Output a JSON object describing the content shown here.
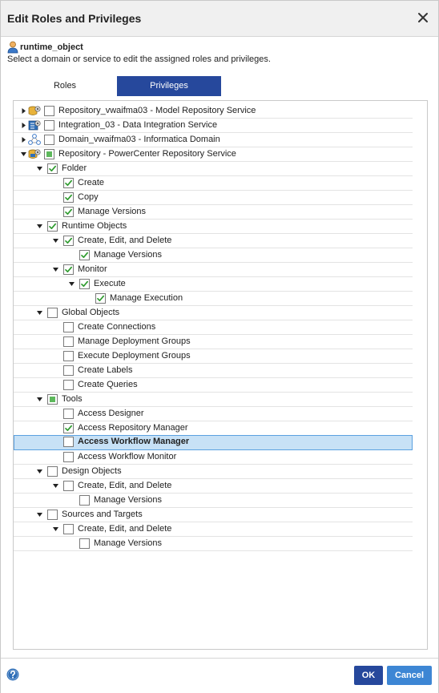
{
  "dialog": {
    "title": "Edit Roles and Privileges",
    "object_name": "runtime_object",
    "instructions": "Select a domain or service to edit the assigned roles and privileges."
  },
  "tabs": [
    {
      "label": "Roles",
      "active": false
    },
    {
      "label": "Privileges",
      "active": true
    }
  ],
  "tree": [
    {
      "label": "Repository_vwaifma03 - Model Repository Service",
      "level": 0,
      "expander": "collapsed",
      "check": "unchecked",
      "icon": "model-repository-icon"
    },
    {
      "label": "Integration_03 - Data Integration Service",
      "level": 0,
      "expander": "collapsed",
      "check": "unchecked",
      "icon": "data-integration-icon"
    },
    {
      "label": "Domain_vwaifma03 - Informatica Domain",
      "level": 0,
      "expander": "collapsed",
      "check": "unchecked",
      "icon": "domain-icon"
    },
    {
      "label": "Repository - PowerCenter Repository Service",
      "level": 0,
      "expander": "expanded",
      "check": "partial",
      "icon": "powercenter-repository-icon"
    },
    {
      "label": "Folder",
      "level": 1,
      "expander": "expanded",
      "check": "checked"
    },
    {
      "label": "Create",
      "level": 2,
      "expander": "none",
      "check": "checked"
    },
    {
      "label": "Copy",
      "level": 2,
      "expander": "none",
      "check": "checked"
    },
    {
      "label": "Manage Versions",
      "level": 2,
      "expander": "none",
      "check": "checked"
    },
    {
      "label": "Runtime Objects",
      "level": 1,
      "expander": "expanded",
      "check": "checked"
    },
    {
      "label": "Create, Edit, and Delete",
      "level": 2,
      "expander": "expanded",
      "check": "checked"
    },
    {
      "label": "Manage Versions",
      "level": 3,
      "expander": "none",
      "check": "checked"
    },
    {
      "label": "Monitor",
      "level": 2,
      "expander": "expanded",
      "check": "checked"
    },
    {
      "label": "Execute",
      "level": 3,
      "expander": "expanded",
      "check": "checked"
    },
    {
      "label": "Manage Execution",
      "level": 4,
      "expander": "none",
      "check": "checked"
    },
    {
      "label": "Global Objects",
      "level": 1,
      "expander": "expanded",
      "check": "unchecked"
    },
    {
      "label": "Create Connections",
      "level": 2,
      "expander": "none",
      "check": "unchecked"
    },
    {
      "label": "Manage Deployment Groups",
      "level": 2,
      "expander": "none",
      "check": "unchecked"
    },
    {
      "label": "Execute Deployment Groups",
      "level": 2,
      "expander": "none",
      "check": "unchecked"
    },
    {
      "label": "Create Labels",
      "level": 2,
      "expander": "none",
      "check": "unchecked"
    },
    {
      "label": "Create Queries",
      "level": 2,
      "expander": "none",
      "check": "unchecked"
    },
    {
      "label": "Tools",
      "level": 1,
      "expander": "expanded",
      "check": "partial"
    },
    {
      "label": "Access Designer",
      "level": 2,
      "expander": "none",
      "check": "unchecked"
    },
    {
      "label": "Access Repository Manager",
      "level": 2,
      "expander": "none",
      "check": "checked"
    },
    {
      "label": "Access Workflow Manager",
      "level": 2,
      "expander": "none",
      "check": "unchecked",
      "selected": true
    },
    {
      "label": "Access Workflow Monitor",
      "level": 2,
      "expander": "none",
      "check": "unchecked"
    },
    {
      "label": "Design Objects",
      "level": 1,
      "expander": "expanded",
      "check": "unchecked"
    },
    {
      "label": "Create, Edit, and Delete",
      "level": 2,
      "expander": "expanded",
      "check": "unchecked"
    },
    {
      "label": "Manage Versions",
      "level": 3,
      "expander": "none",
      "check": "unchecked"
    },
    {
      "label": "Sources and Targets",
      "level": 1,
      "expander": "expanded",
      "check": "unchecked"
    },
    {
      "label": "Create, Edit, and Delete",
      "level": 2,
      "expander": "expanded",
      "check": "unchecked"
    },
    {
      "label": "Manage Versions",
      "level": 3,
      "expander": "none",
      "check": "unchecked"
    }
  ],
  "footer": {
    "ok_label": "OK",
    "cancel_label": "Cancel"
  },
  "colors": {
    "accent": "#26489c",
    "cancel": "#3d86d4",
    "check_green": "#2e9b2e",
    "selection": "#c7e1f6"
  }
}
